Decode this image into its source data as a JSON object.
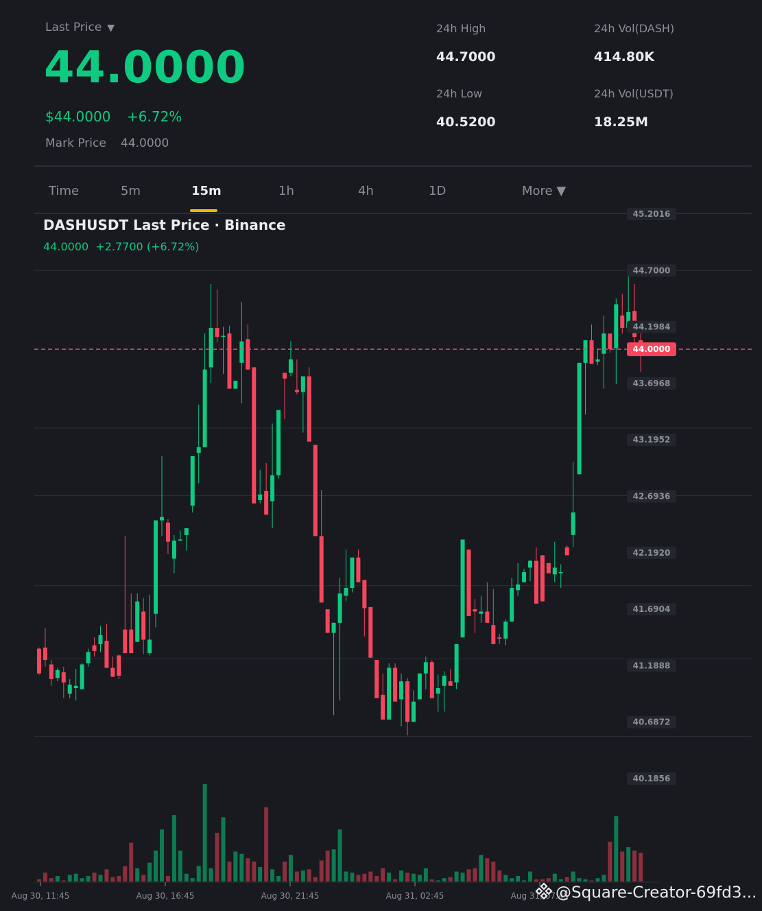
{
  "header": {
    "last_price_label": "Last Price",
    "last_price_caret": "▼",
    "last_price": "44.0000",
    "usd_price": "$44.0000",
    "change_pct": "+6.72%",
    "mark_price_label": "Mark Price",
    "mark_price": "44.0000"
  },
  "stats": {
    "high_label": "24h High",
    "high_value": "44.7000",
    "low_label": "24h Low",
    "low_value": "40.5200",
    "vol_base_label": "24h Vol(DASH)",
    "vol_base_value": "414.80K",
    "vol_quote_label": "24h Vol(USDT)",
    "vol_quote_value": "18.25M"
  },
  "timeframes": {
    "time": "Time",
    "m5": "5m",
    "m15": "15m",
    "h1": "1h",
    "h4": "4h",
    "d1": "1D",
    "more": "More ▼",
    "active": "15m"
  },
  "chart_title": "DASHUSDT Last Price · Binance",
  "chart_subtitle": "44.0000  +2.7700 (+6.72%)",
  "watermark": "@Square-Creator-69fd3...",
  "colors": {
    "up": "#0ecb81",
    "down": "#f6465d",
    "bg": "#181a1f",
    "grid": "#2b2f36",
    "accent": "#f0b90b"
  },
  "chart_data": {
    "type": "candlestick",
    "interval": "15m",
    "y_ticks": [
      "45.2016",
      "44.7000",
      "44.1984",
      "43.6968",
      "43.1952",
      "42.6936",
      "42.1920",
      "41.6904",
      "41.1888",
      "40.6872",
      "40.1856"
    ],
    "ylim": [
      40.1856,
      45.2016
    ],
    "x_ticks": [
      "Aug 30, 11:45",
      "Aug 30, 16:45",
      "Aug 30, 21:45",
      "Aug 31, 02:45",
      "Aug 31, 07:45"
    ],
    "last_price_line": 44.0,
    "last_price_label": "44.0000",
    "candles": [
      [
        41.34,
        41.35,
        41.11,
        41.12
      ],
      [
        41.35,
        41.52,
        41.18,
        41.24
      ],
      [
        41.2,
        41.24,
        41.01,
        41.07
      ],
      [
        41.08,
        41.17,
        41.05,
        41.15
      ],
      [
        41.13,
        41.18,
        40.9,
        41.04
      ],
      [
        40.94,
        41.07,
        40.9,
        41.02
      ],
      [
        40.99,
        41.16,
        40.88,
        41.01
      ],
      [
        40.98,
        41.21,
        40.98,
        41.2
      ],
      [
        41.21,
        41.34,
        41.18,
        41.31
      ],
      [
        41.37,
        41.44,
        41.27,
        41.32
      ],
      [
        41.38,
        41.54,
        41.31,
        41.46
      ],
      [
        41.41,
        41.56,
        41.19,
        41.17
      ],
      [
        41.17,
        41.27,
        41.09,
        41.09
      ],
      [
        41.28,
        41.29,
        41.07,
        41.1
      ],
      [
        41.51,
        42.34,
        41.51,
        41.3
      ],
      [
        41.51,
        41.83,
        41.4,
        41.3
      ],
      [
        41.4,
        41.83,
        41.43,
        41.76
      ],
      [
        41.67,
        41.79,
        41.29,
        41.42
      ],
      [
        41.3,
        41.82,
        41.28,
        41.42
      ],
      [
        41.65,
        41.66,
        41.53,
        42.48
      ],
      [
        42.48,
        43.05,
        42.34,
        42.51
      ],
      [
        42.46,
        42.49,
        42.18,
        42.29
      ],
      [
        42.14,
        42.35,
        42.01,
        42.3
      ],
      [
        42.3,
        42.39,
        42.35,
        42.31
      ],
      [
        42.35,
        42.16,
        42.21,
        42.41
      ],
      [
        42.61,
        42.56,
        42.55,
        43.05
      ],
      [
        43.08,
        43.51,
        42.81,
        43.13
      ],
      [
        43.13,
        44.14,
        43.4,
        43.82
      ],
      [
        43.84,
        44.58,
        43.7,
        44.19
      ],
      [
        44.19,
        44.53,
        44.06,
        44.11
      ],
      [
        44.11,
        44.2,
        43.78,
        44.12
      ],
      [
        44.14,
        44.21,
        43.79,
        43.65
      ],
      [
        43.65,
        43.7,
        43.75,
        43.72
      ],
      [
        43.88,
        44.42,
        43.52,
        44.07
      ],
      [
        44.09,
        44.22,
        43.87,
        43.82
      ],
      [
        43.84,
        43.8,
        43.78,
        42.63
      ],
      [
        42.66,
        42.93,
        42.63,
        42.71
      ],
      [
        42.74,
        42.99,
        42.59,
        42.53
      ],
      [
        42.65,
        43.34,
        42.41,
        42.88
      ],
      [
        42.88,
        43.05,
        42.85,
        43.46
      ],
      [
        43.79,
        43.35,
        43.38,
        43.74
      ],
      [
        43.79,
        44.07,
        43.76,
        43.91
      ],
      [
        43.64,
        43.91,
        43.6,
        43.62
      ],
      [
        43.62,
        43.56,
        43.26,
        43.76
      ],
      [
        43.76,
        43.84,
        43.52,
        43.18
      ],
      [
        43.15,
        42.83,
        42.83,
        42.34
      ],
      [
        42.34,
        42.75,
        42.13,
        41.75
      ],
      [
        41.69,
        41.21,
        41.84,
        41.48
      ],
      [
        41.48,
        41.56,
        40.75,
        41.57
      ],
      [
        41.57,
        41.97,
        40.88,
        41.83
      ],
      [
        41.81,
        42.22,
        41.76,
        41.88
      ],
      [
        41.88,
        41.86,
        41.84,
        42.15
      ],
      [
        42.15,
        42.22,
        41.93,
        41.93
      ],
      [
        41.95,
        41.85,
        41.45,
        41.7
      ],
      [
        41.71,
        41.51,
        41.46,
        41.26
      ],
      [
        41.24,
        41.21,
        41.04,
        40.9
      ],
      [
        40.93,
        41.12,
        40.96,
        40.71
      ],
      [
        40.71,
        41.21,
        40.71,
        41.17
      ],
      [
        41.17,
        41.21,
        40.96,
        40.87
      ],
      [
        40.89,
        41.12,
        40.65,
        41.05
      ],
      [
        41.05,
        41.08,
        40.57,
        40.69
      ],
      [
        40.69,
        40.97,
        40.71,
        40.87
      ],
      [
        40.89,
        41.02,
        40.99,
        41.12
      ],
      [
        41.12,
        41.27,
        40.98,
        41.22
      ],
      [
        41.22,
        41.24,
        40.94,
        40.9
      ],
      [
        40.94,
        41.11,
        40.78,
        40.99
      ],
      [
        41.01,
        41.14,
        40.78,
        41.1
      ],
      [
        41.05,
        41.16,
        41.05,
        41.01
      ],
      [
        41.04,
        41.34,
        40.98,
        41.38
      ],
      [
        41.44,
        42.3,
        41.46,
        42.31
      ],
      [
        42.22,
        42.17,
        41.65,
        41.63
      ],
      [
        41.69,
        41.78,
        41.48,
        41.67
      ],
      [
        41.65,
        41.81,
        41.57,
        41.67
      ],
      [
        41.67,
        41.93,
        41.67,
        41.57
      ],
      [
        41.55,
        41.87,
        41.48,
        41.38
      ],
      [
        41.44,
        41.47,
        41.38,
        41.43
      ],
      [
        41.43,
        41.6,
        41.37,
        41.58
      ],
      [
        41.58,
        41.97,
        41.62,
        41.88
      ],
      [
        41.86,
        42.1,
        41.81,
        41.91
      ],
      [
        41.93,
        42.05,
        41.95,
        42.02
      ],
      [
        42.06,
        42.13,
        41.94,
        42.12
      ],
      [
        42.12,
        42.24,
        41.9,
        41.74
      ],
      [
        42.17,
        42.12,
        41.97,
        41.76
      ],
      [
        42.1,
        42.06,
        42.06,
        42.01
      ],
      [
        42.0,
        42.29,
        41.93,
        42.06
      ],
      [
        42.02,
        42.09,
        41.88,
        42.02
      ],
      [
        42.24,
        42.26,
        42.24,
        42.17
      ],
      [
        42.35,
        43.0,
        42.24,
        42.55
      ],
      [
        42.89,
        43.06,
        42.91,
        43.88
      ],
      [
        43.88,
        43.97,
        43.42,
        44.08
      ],
      [
        44.08,
        44.22,
        43.96,
        43.87
      ],
      [
        43.89,
        44.0,
        43.86,
        43.91
      ],
      [
        43.96,
        44.3,
        43.65,
        44.14
      ],
      [
        44.14,
        44.12,
        43.97,
        44.0
      ],
      [
        44.01,
        44.45,
        43.69,
        44.4
      ],
      [
        44.3,
        44.49,
        44.14,
        44.19
      ],
      [
        44.19,
        44.66,
        44.15,
        44.33
      ],
      [
        44.34,
        44.58,
        43.96,
        44.11
      ],
      [
        44.08,
        44.14,
        43.8,
        44.0
      ]
    ],
    "volume": [
      2,
      8,
      3,
      5,
      1,
      6,
      7,
      3,
      5,
      8,
      6,
      11,
      4,
      5,
      14,
      35,
      12,
      6,
      17,
      28,
      47,
      5,
      60,
      28,
      7,
      3,
      14,
      88,
      12,
      44,
      58,
      18,
      27,
      25,
      21,
      18,
      13,
      67,
      11,
      5,
      18,
      24,
      9,
      10,
      11,
      4,
      19,
      28,
      29,
      47,
      9,
      8,
      6,
      7,
      9,
      5,
      12,
      8,
      2,
      10,
      8,
      7,
      6,
      12,
      2,
      1,
      3,
      4,
      9,
      8,
      11,
      12,
      24,
      21,
      18,
      10,
      6,
      3,
      5,
      1,
      9,
      2,
      2,
      3,
      7,
      2,
      4,
      9,
      3,
      2,
      1,
      3,
      6,
      36,
      59,
      27,
      31,
      28,
      26,
      12,
      19,
      18
    ]
  }
}
